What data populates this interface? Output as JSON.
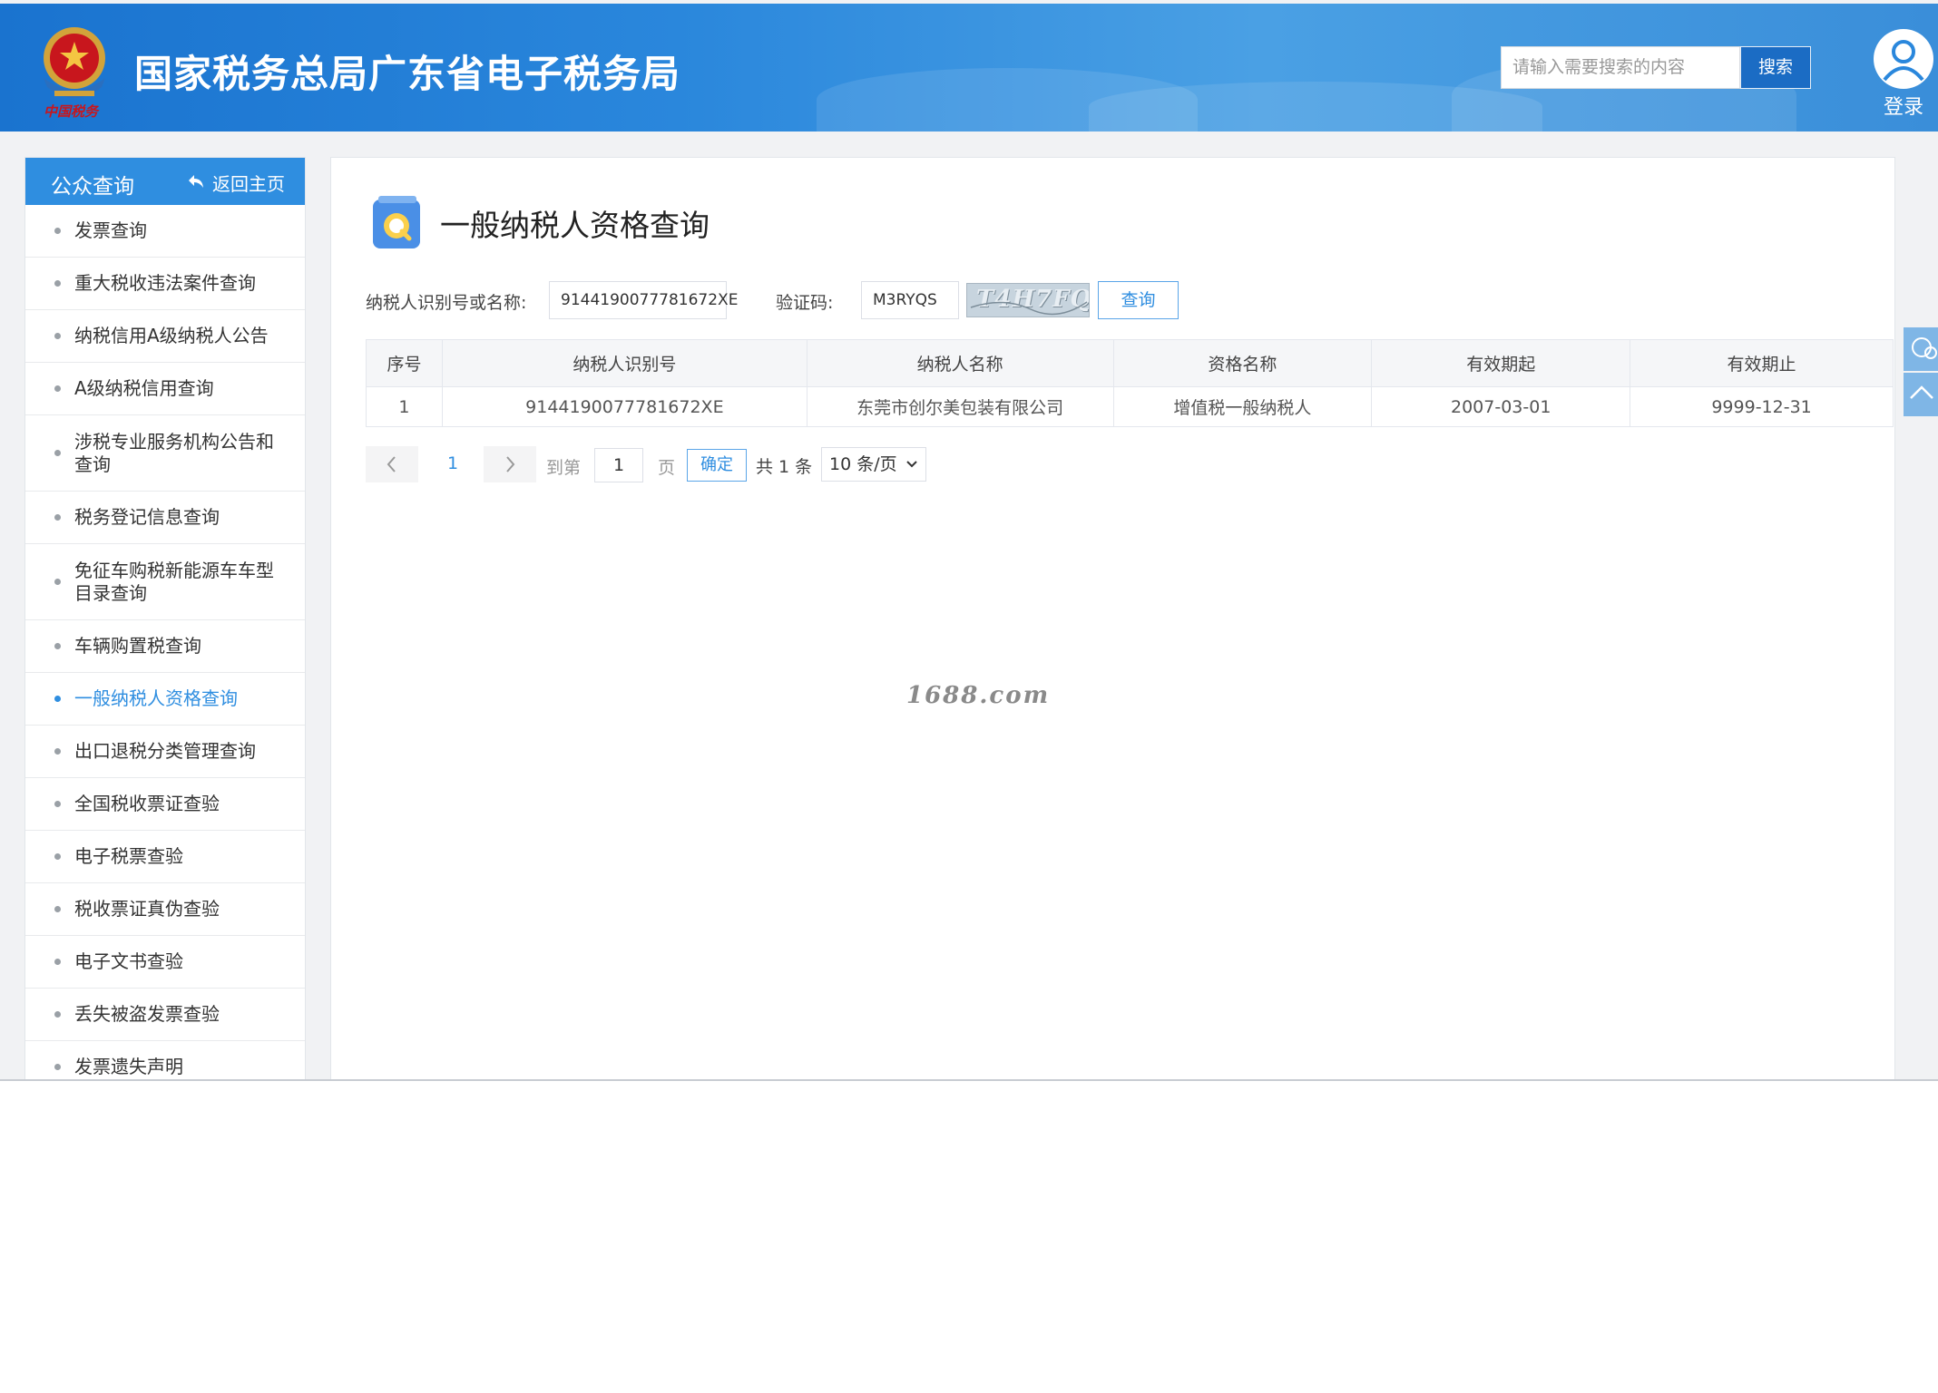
{
  "header": {
    "site_title": "国家税务总局广东省电子税务局",
    "emblem_text": "中国税务",
    "search_placeholder": "请输入需要搜索的内容",
    "search_button": "搜索",
    "login_label": "登录"
  },
  "sidebar": {
    "title": "公众查询",
    "back_label": "返回主页",
    "items": [
      {
        "label": "发票查询",
        "tall": false,
        "active": false
      },
      {
        "label": "重大税收违法案件查询",
        "tall": false,
        "active": false
      },
      {
        "label": "纳税信用A级纳税人公告",
        "tall": false,
        "active": false
      },
      {
        "label": "A级纳税信用查询",
        "tall": false,
        "active": false
      },
      {
        "label": "涉税专业服务机构公告和查询",
        "tall": true,
        "active": false
      },
      {
        "label": "税务登记信息查询",
        "tall": false,
        "active": false
      },
      {
        "label": "免征车购税新能源车车型目录查询",
        "tall": true,
        "active": false
      },
      {
        "label": "车辆购置税查询",
        "tall": false,
        "active": false
      },
      {
        "label": "一般纳税人资格查询",
        "tall": false,
        "active": true
      },
      {
        "label": "出口退税分类管理查询",
        "tall": false,
        "active": false
      },
      {
        "label": "全国税收票证查验",
        "tall": false,
        "active": false
      },
      {
        "label": "电子税票查验",
        "tall": false,
        "active": false
      },
      {
        "label": "税收票证真伪查验",
        "tall": false,
        "active": false
      },
      {
        "label": "电子文书查验",
        "tall": false,
        "active": false
      },
      {
        "label": "丢失被盗发票查验",
        "tall": false,
        "active": false
      },
      {
        "label": "发票遗失声明",
        "tall": false,
        "active": false
      }
    ]
  },
  "main": {
    "page_title": "一般纳税人资格查询",
    "form": {
      "taxpayer_label": "纳税人识别号或名称:",
      "taxpayer_value": "9144190077781672XE",
      "captcha_label": "验证码:",
      "captcha_value": "M3RYQS",
      "captcha_image_text": "T4H7FQ",
      "query_button": "查询"
    },
    "table": {
      "headers": [
        "序号",
        "纳税人识别号",
        "纳税人名称",
        "资格名称",
        "有效期起",
        "有效期止"
      ],
      "rows": [
        [
          "1",
          "9144190077781672XE",
          "东莞市创尔美包装有限公司",
          "增值税一般纳税人",
          "2007-03-01",
          "9999-12-31"
        ]
      ]
    },
    "pagination": {
      "current_page": "1",
      "goto_label": "到第",
      "goto_value": "1",
      "page_unit": "页",
      "confirm_label": "确定",
      "total_text": "共 1 条",
      "page_size": "10 条/页"
    },
    "watermark": "1688.com"
  },
  "colors": {
    "header_blue": "#1a73cf",
    "accent_blue": "#2f8ee0",
    "search_button": "#1b6cc4"
  }
}
